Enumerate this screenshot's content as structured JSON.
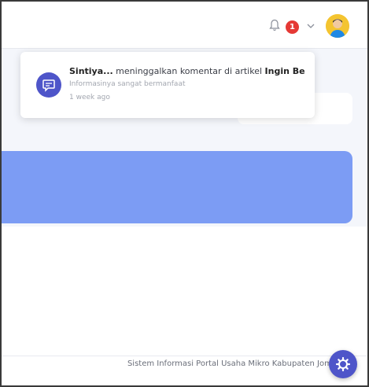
{
  "header": {
    "notification_count": "1",
    "avatar_icon": "user-avatar-icon",
    "bell_icon": "bell-icon",
    "chevron_icon": "chevron-down-icon"
  },
  "notification": {
    "actor": "Sintiya...",
    "action": " meninggalkan komentar di artikel ",
    "article": "Ingin Be...",
    "body": "Informasinya sangat bermanfaat",
    "time": "1 week ago",
    "icon": "comment-icon"
  },
  "footer": {
    "text": "Sistem Informasi Portal Usaha Mikro Kabupaten Jombang"
  },
  "fab": {
    "icon": "gear-icon"
  },
  "colors": {
    "accent": "#4e55c9",
    "banner": "#7c9cf4",
    "badge": "#e53935"
  }
}
